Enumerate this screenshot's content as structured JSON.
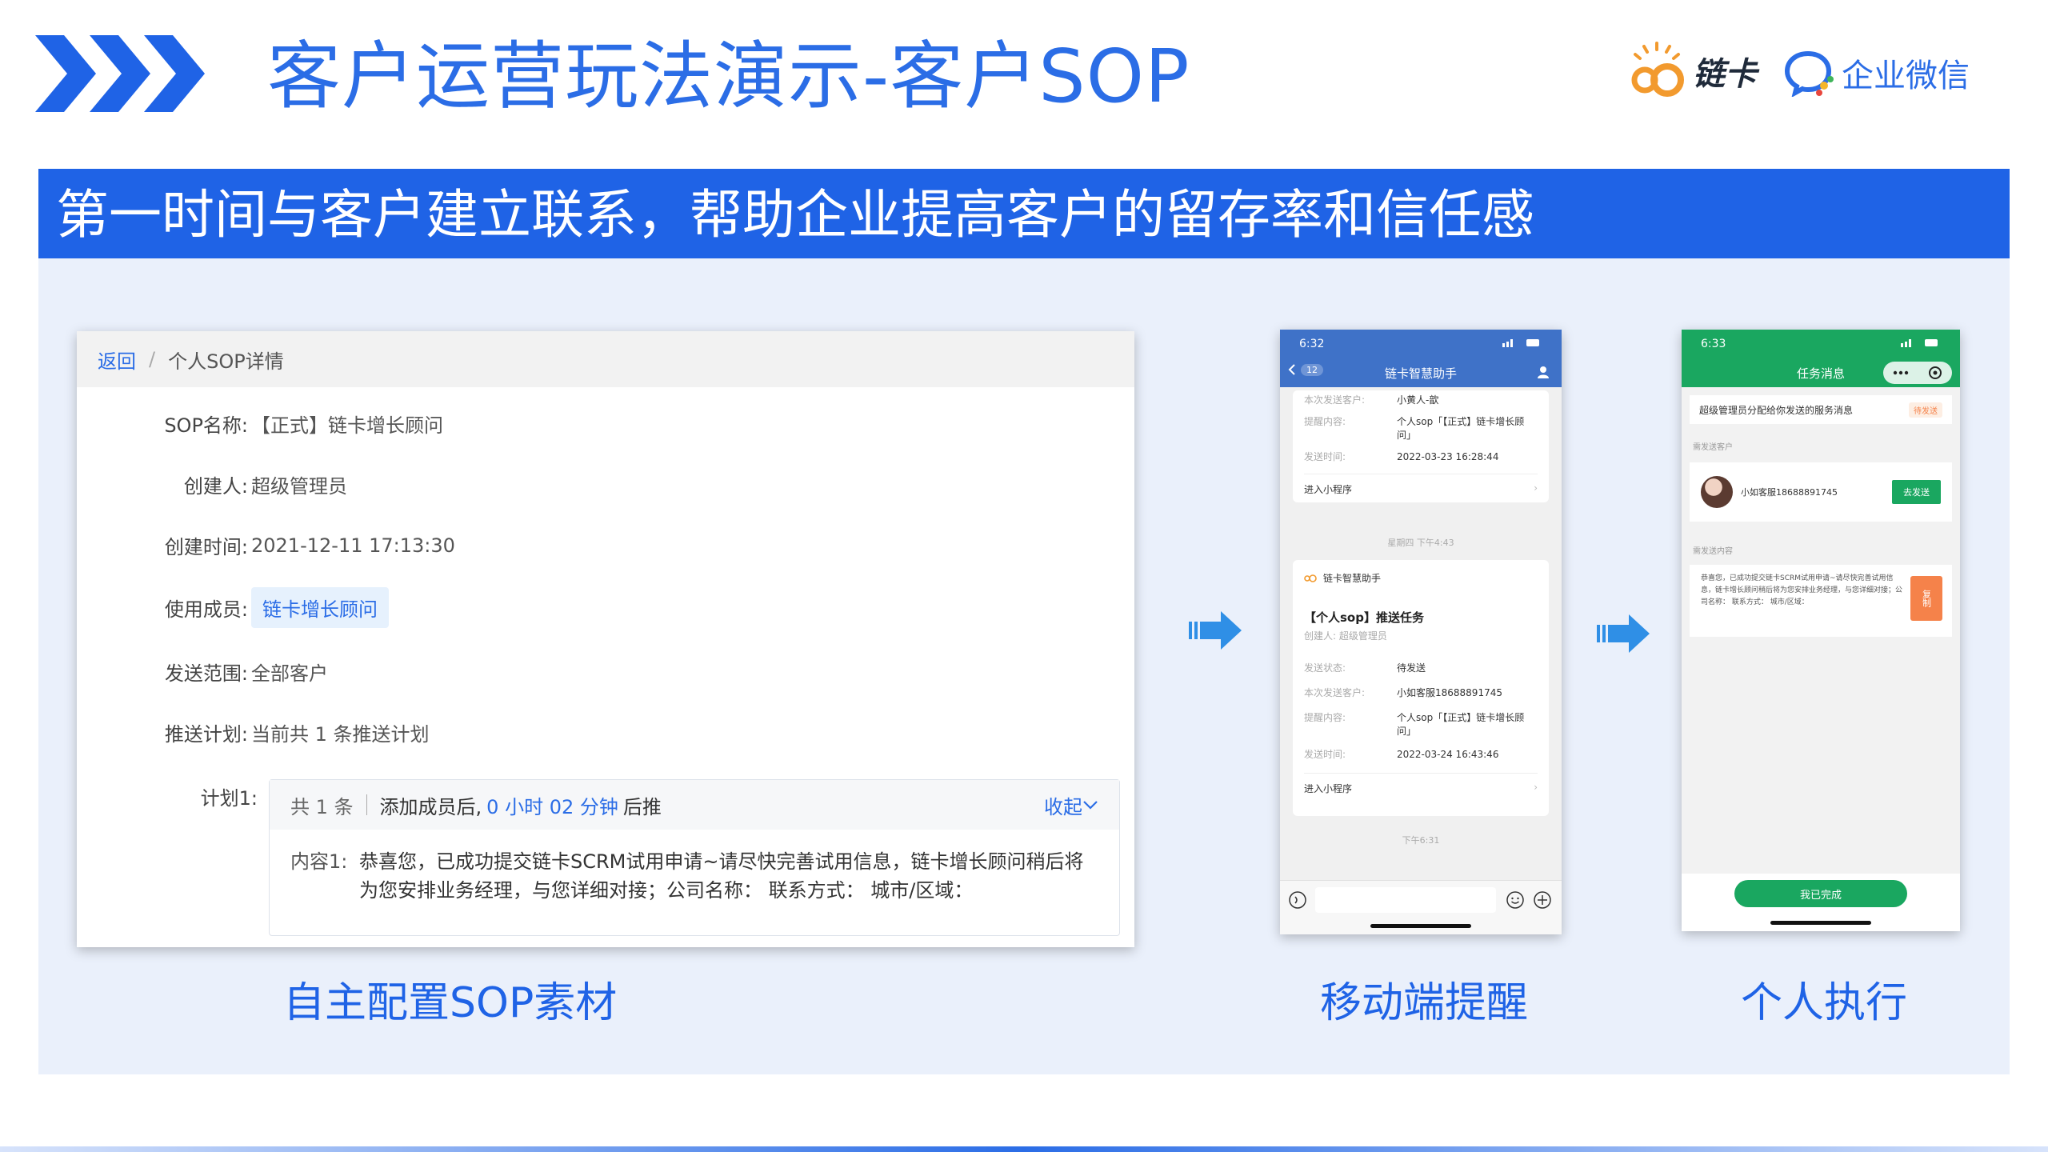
{
  "header": {
    "title": "客户运营玩法演示-客户SOP",
    "logo_lianka": "链卡",
    "logo_wecom": "企业微信"
  },
  "banner": {
    "text": "第一时间与客户建立联系，帮助企业提高客户的留存率和信任感"
  },
  "sop_detail": {
    "back_label": "返回",
    "breadcrumb_sep": "/",
    "page_name": "个人SOP详情",
    "fields": [
      {
        "label": "SOP名称:",
        "value": "【正式】链卡增长顾问"
      },
      {
        "label": "创建人:",
        "value": "超级管理员"
      },
      {
        "label": "创建时间:",
        "value": "2021-12-11 17:13:30"
      },
      {
        "label": "使用成员:",
        "value": "链卡增长顾问"
      },
      {
        "label": "发送范围:",
        "value": "全部客户"
      },
      {
        "label": "推送计划:",
        "value": "当前共 1 条推送计划"
      }
    ],
    "plan": {
      "label": "计划1:",
      "count": "共 1 条",
      "trigger_prefix": "添加成员后,",
      "trigger_time": "0 小时 02 分钟",
      "trigger_suffix": "后推",
      "collapse_label": "收起",
      "content_label": "内容1:",
      "content_text": "恭喜您，已成功提交链卡SCRM试用申请~请尽快完善试用信息，链卡增长顾问稍后将为您安排业务经理，与您详细对接；公司名称： 联系方式： 城市/区域："
    }
  },
  "phone_reminder": {
    "status_time": "6:32",
    "nav_title": "链卡智慧助手",
    "nav_badge": "12",
    "card1": {
      "customer_label": "本次发送客户:",
      "customer_value": "小黄人-歆",
      "content_label": "提醒内容:",
      "content_value": "个人sop「【正式】链卡增长顾问」",
      "time_label": "发送时间:",
      "time_value": "2022-03-23 16:28:44",
      "link": "进入小程序"
    },
    "time_tag1": "星期四 下午4:43",
    "card2": {
      "sender": "链卡智慧助手",
      "title": "【个人sop】推送任务",
      "creator": "创建人: 超级管理员",
      "status_label": "发送状态:",
      "status_value": "待发送",
      "customer_label": "本次发送客户:",
      "customer_value": "小如客服18688891745",
      "content_label": "提醒内容:",
      "content_value": "个人sop「【正式】链卡增长顾问」",
      "time_label": "发送时间:",
      "time_value": "2022-03-24 16:43:46",
      "link": "进入小程序"
    },
    "time_tag2": "下午6:31"
  },
  "phone_execute": {
    "status_time": "6:33",
    "nav_title": "任务消息",
    "notice": "超级管理员分配给你发送的服务消息",
    "notice_badge": "待发送",
    "section_customer": "需发送客户",
    "customer_name": "小如客服18688891745",
    "send_button": "去发送",
    "section_content": "需发送内容",
    "content_text": "恭喜您，已成功提交链卡SCRM试用申请~请尽快完善试用信息，链卡增长顾问稍后将为您安排业务经理，与您详细对接；公司名称： 联系方式： 城市/区域：",
    "copy_button": "复制",
    "done_button": "我已完成"
  },
  "captions": {
    "left": "自主配置SOP素材",
    "middle": "移动端提醒",
    "right": "个人执行"
  },
  "colors": {
    "brand_blue": "#1f63e6",
    "panel_bg": "#eaf0fb",
    "wecom_green": "#1aa760",
    "copy_orange": "#f5824a"
  }
}
